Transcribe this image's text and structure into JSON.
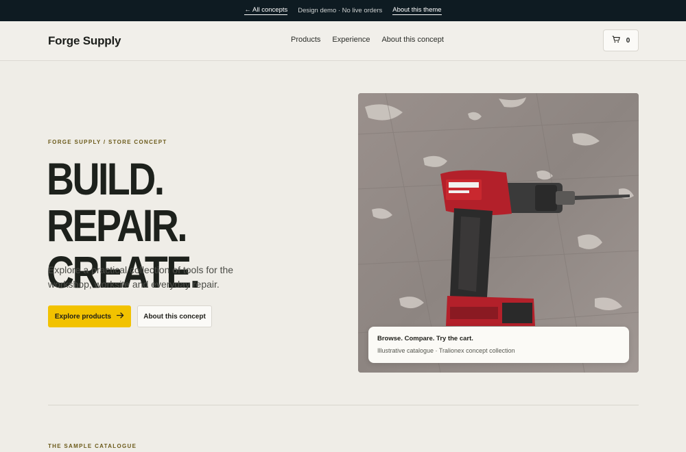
{
  "topbar": {
    "back_link": "← All concepts",
    "notice": "Design demo · No live orders",
    "about_theme": "About this theme"
  },
  "header": {
    "logo": "Forge Supply",
    "nav": [
      "Products",
      "Experience",
      "About this concept"
    ],
    "cart_count": "0",
    "cart_icon": "shopping-cart-icon"
  },
  "hero": {
    "eyebrow": "FORGE SUPPLY / STORE CONCEPT",
    "headline_line1": "BUILD. REPAIR.",
    "headline_line2": "CREATE.",
    "lede": "Explore a practical collection of tools for the workshop, worksite and everyday repair.",
    "primary_cta": "Explore products",
    "primary_cta_icon": "arrow-right-icon",
    "secondary_cta": "About this concept",
    "caption_title": "Browse. Compare. Try the cart.",
    "caption_subtitle": "Illustrative catalogue · Tralionex concept collection"
  },
  "catalogue": {
    "section_label": "THE SAMPLE CATALOGUE"
  },
  "colors": {
    "topbar_bg": "#0e1b22",
    "page_bg": "#efede7",
    "accent_yellow": "#f2c200",
    "drill_red": "#b3202a"
  }
}
